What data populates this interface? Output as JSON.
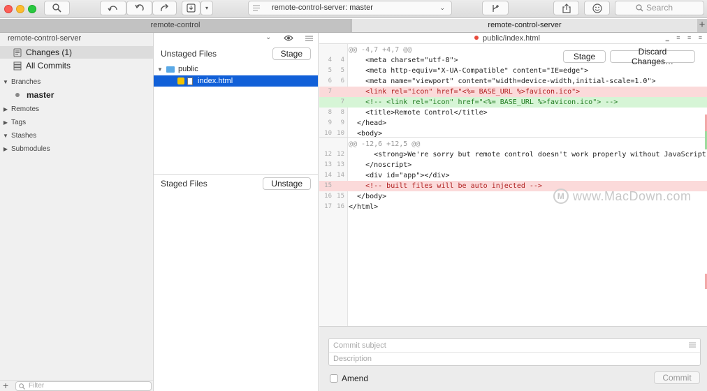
{
  "toolbar": {
    "branch_selector": "remote-control-server: master",
    "search_placeholder": "Search"
  },
  "tabs": [
    {
      "label": "remote-control"
    },
    {
      "label": "remote-control-server"
    }
  ],
  "sidebar": {
    "repo_name": "remote-control-server",
    "items": [
      {
        "label": "Changes (1)"
      },
      {
        "label": "All Commits"
      }
    ],
    "sections": {
      "branches": "Branches",
      "current_branch": "master",
      "remotes": "Remotes",
      "tags": "Tags",
      "stashes": "Stashes",
      "submodules": "Submodules"
    },
    "filter_placeholder": "Filter"
  },
  "staging": {
    "unstaged_title": "Unstaged Files",
    "stage_label": "Stage",
    "folder": "public",
    "file": "index.html",
    "staged_title": "Staged Files",
    "unstage_label": "Unstage"
  },
  "diff": {
    "filename": "public/index.html",
    "stage_label": "Stage",
    "discard_label": "Discard Changes…",
    "lines": [
      {
        "type": "hunk",
        "old": "",
        "new": "",
        "text": "@@ -4,7 +4,7 @@"
      },
      {
        "type": "ctx",
        "old": "4",
        "new": "4",
        "text": "    <meta charset=\"utf-8\">"
      },
      {
        "type": "ctx",
        "old": "5",
        "new": "5",
        "text": "    <meta http-equiv=\"X-UA-Compatible\" content=\"IE=edge\">"
      },
      {
        "type": "ctx",
        "old": "6",
        "new": "6",
        "text": "    <meta name=\"viewport\" content=\"width=device-width,initial-scale=1.0\">"
      },
      {
        "type": "del",
        "old": "7",
        "new": "",
        "text": "    <link rel=\"icon\" href=\"<%= BASE_URL %>favicon.ico\">"
      },
      {
        "type": "add",
        "old": "",
        "new": "7",
        "text": "    <!-- <link rel=\"icon\" href=\"<%= BASE_URL %>favicon.ico\"> -->"
      },
      {
        "type": "ctx",
        "old": "8",
        "new": "8",
        "text": "    <title>Remote Control</title>"
      },
      {
        "type": "ctx",
        "old": "9",
        "new": "9",
        "text": "  </head>"
      },
      {
        "type": "ctx",
        "old": "10",
        "new": "10",
        "text": "  <body>"
      },
      {
        "type": "hunk",
        "old": "",
        "new": "",
        "text": "@@ -12,6 +12,5 @@"
      },
      {
        "type": "ctx",
        "old": "12",
        "new": "12",
        "text": "      <strong>We're sorry but remote control doesn't work properly without JavaScript ena"
      },
      {
        "type": "ctx",
        "old": "13",
        "new": "13",
        "text": "    </noscript>"
      },
      {
        "type": "ctx",
        "old": "14",
        "new": "14",
        "text": "    <div id=\"app\"></div>"
      },
      {
        "type": "del",
        "old": "15",
        "new": "",
        "text": "    <!-- built files will be auto injected -->"
      },
      {
        "type": "ctx",
        "old": "16",
        "new": "15",
        "text": "  </body>"
      },
      {
        "type": "ctx",
        "old": "17",
        "new": "16",
        "text": "</html>"
      }
    ]
  },
  "commit": {
    "subject_placeholder": "Commit subject",
    "description_placeholder": "Description",
    "amend_label": "Amend",
    "commit_label": "Commit"
  },
  "watermark": {
    "text": "www.MacDown.com"
  }
}
